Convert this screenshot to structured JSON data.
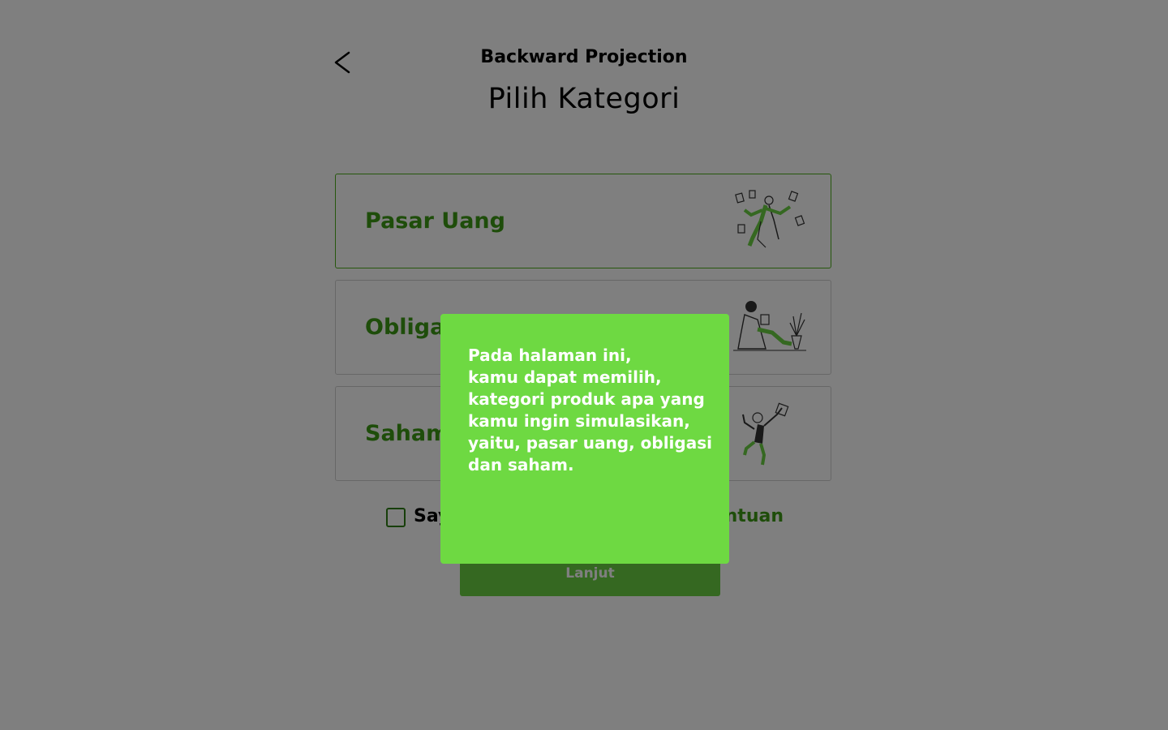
{
  "header": {
    "back_icon": "chevron-left-icon",
    "app_title": "Backward Projection",
    "page_title": "Pilih Kategori"
  },
  "categories": [
    {
      "label": "Pasar Uang",
      "illustration": "juggling-person-illustration",
      "selected": true
    },
    {
      "label": "Obligasi",
      "illustration": "sitting-person-reading-illustration",
      "selected": false
    },
    {
      "label": "Saham",
      "illustration": "dancing-person-illustration",
      "selected": false
    }
  ],
  "agreement": {
    "text": "Say",
    "help_link": "ntuan",
    "checked": false
  },
  "next_button": {
    "label": "Lanjut"
  },
  "tooltip": {
    "lines": [
      "Pada halaman ini,",
      "kamu dapat memilih,",
      "kategori produk apa yang",
      "kamu ingin simulasikan,",
      "yaitu, pasar uang, obligasi",
      "dan saham."
    ]
  },
  "colors": {
    "accent_green": "#3c9a14",
    "tooltip_green": "#6ed942",
    "button_green": "#6bd142",
    "overlay": "rgba(0,0,0,0.5)"
  }
}
